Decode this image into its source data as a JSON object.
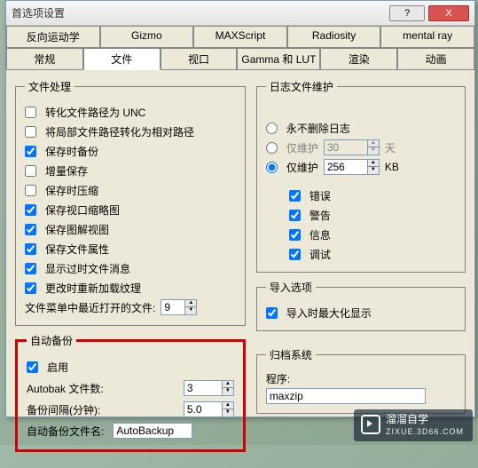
{
  "window": {
    "title": "首选项设置"
  },
  "tabs_row1": [
    "反向运动学",
    "Gizmo",
    "MAXScript",
    "Radiosity",
    "mental ray"
  ],
  "tabs_row2": [
    "常规",
    "文件",
    "视口",
    "Gamma 和 LUT",
    "渲染",
    "动画"
  ],
  "active_tab": "文件",
  "file_handling": {
    "legend": "文件处理",
    "cb_unc": {
      "label": "转化文件路径为 UNC",
      "checked": false
    },
    "cb_local_rel": {
      "label": "将局部文件路径转化为相对路径",
      "checked": false
    },
    "cb_backup": {
      "label": "保存时备份",
      "checked": true
    },
    "cb_incremental": {
      "label": "增量保存",
      "checked": false
    },
    "cb_compress": {
      "label": "保存时压缩",
      "checked": false
    },
    "cb_thumb": {
      "label": "保存视口缩略图",
      "checked": true
    },
    "cb_schematic": {
      "label": "保存图解视图",
      "checked": true
    },
    "cb_props": {
      "label": "保存文件属性",
      "checked": true
    },
    "cb_obsolete": {
      "label": "显示过时文件消息",
      "checked": true
    },
    "cb_reload_tex": {
      "label": "更改时重新加载纹理",
      "checked": true
    },
    "recent_label": "文件菜单中最近打开的文件:",
    "recent_value": "9"
  },
  "autobackup": {
    "legend": "自动备份",
    "cb_enable": {
      "label": "启用",
      "checked": true
    },
    "files_label": "Autobak 文件数:",
    "files_value": "3",
    "interval_label": "备份间隔(分钟):",
    "interval_value": "5.0",
    "name_label": "自动备份文件名:",
    "name_value": "AutoBackup"
  },
  "log_maint": {
    "legend": "日志文件维护",
    "r_never": {
      "label": "永不删除日志",
      "checked": true
    },
    "r_days": {
      "label": "仅维护",
      "checked": false,
      "value": "30",
      "unit": "天"
    },
    "r_kb": {
      "label": "仅维护",
      "checked": true,
      "value": "256",
      "unit": "KB"
    },
    "cb_error": {
      "label": "错误",
      "checked": true
    },
    "cb_warn": {
      "label": "警告",
      "checked": true
    },
    "cb_info": {
      "label": "信息",
      "checked": true
    },
    "cb_debug": {
      "label": "调试",
      "checked": true
    }
  },
  "import_opts": {
    "legend": "导入选项",
    "cb_maximize": {
      "label": "导入时最大化显示",
      "checked": true
    }
  },
  "archive": {
    "legend": "归档系统",
    "prog_label": "程序:",
    "prog_value": "maxzip"
  },
  "watermark": {
    "big": "溜溜自学",
    "small": "ZIXUE.3D66.COM"
  }
}
